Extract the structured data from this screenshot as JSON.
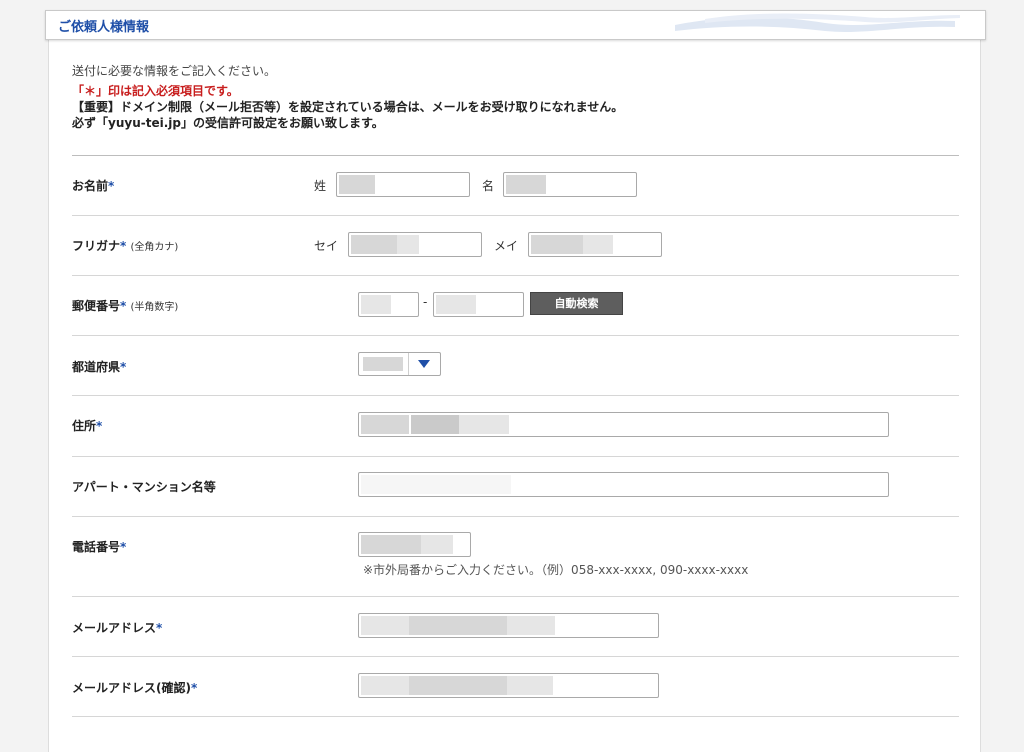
{
  "header": {
    "title": "ご依頼人様情報"
  },
  "intro": {
    "line1": "送付に必要な情報をご記入ください。",
    "line2": "「＊」印は記入必須項目です。",
    "line3": "【重要】ドメイン制限（メール拒否等）を設定されている場合は、メールをお受け取りになれません。",
    "line4": "必ず「yuyu-tei.jp」の受信許可設定をお願い致します。"
  },
  "form": {
    "name": {
      "label": "お名前",
      "required": "*",
      "last_label": "姓",
      "first_label": "名",
      "last_value": "",
      "first_value": ""
    },
    "kana": {
      "label": "フリガナ",
      "required": "*",
      "note": "(全角カナ)",
      "last_label": "セイ",
      "first_label": "メイ"
    },
    "zip": {
      "label": "郵便番号",
      "required": "*",
      "note": "(半角数字)",
      "separator": "-",
      "search_button": "自動検索"
    },
    "prefecture": {
      "label": "都道府県",
      "required": "*",
      "selected": ""
    },
    "address": {
      "label": "住所",
      "required": "*"
    },
    "building": {
      "label": "アパート・マンション名等"
    },
    "phone": {
      "label": "電話番号",
      "required": "*",
      "hint": "※市外局番からご入力ください。（例）058-xxx-xxxx, 090-xxxx-xxxx"
    },
    "email": {
      "label": "メールアドレス",
      "required": "*"
    },
    "email_confirm": {
      "label": "メールアドレス(確認)",
      "required": "*"
    }
  },
  "colors": {
    "accent": "#1f4fa8",
    "required_text": "#c81e1e",
    "button_bg": "#5e5e5e"
  }
}
